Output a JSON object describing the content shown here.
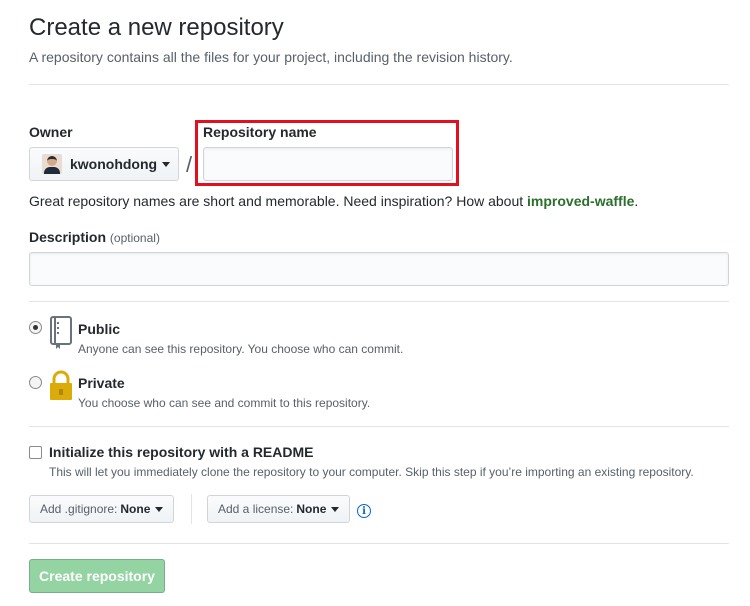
{
  "header": {
    "title": "Create a new repository",
    "subtitle": "A repository contains all the files for your project, including the revision history."
  },
  "owner": {
    "label": "Owner",
    "value": "kwonohdong"
  },
  "repo_name": {
    "label": "Repository name",
    "value": "",
    "placeholder": ""
  },
  "separator": "/",
  "hint": {
    "text": "Great repository names are short and memorable. Need inspiration? How about ",
    "suggestion": "improved-waffle",
    "end": "."
  },
  "description": {
    "label": "Description",
    "optional": "(optional)",
    "value": ""
  },
  "visibility": {
    "selected": "public",
    "public": {
      "title": "Public",
      "desc": "Anyone can see this repository. You choose who can commit.",
      "icon": "repo-icon"
    },
    "private": {
      "title": "Private",
      "desc": "You choose who can see and commit to this repository.",
      "icon": "lock-icon"
    }
  },
  "init": {
    "checked": false,
    "title": "Initialize this repository with a README",
    "desc": "This will let you immediately clone the repository to your computer. Skip this step if you’re importing an existing repository."
  },
  "gitignore": {
    "label": "Add .gitignore:",
    "value": "None"
  },
  "license": {
    "label": "Add a license:",
    "value": "None"
  },
  "info_icon": "i",
  "create_button": "Create repository",
  "colors": {
    "highlight": "#e0101f",
    "suggestion": "#2c6e2c",
    "create_button_bg": "#94d3a2",
    "info": "#0366d6"
  }
}
